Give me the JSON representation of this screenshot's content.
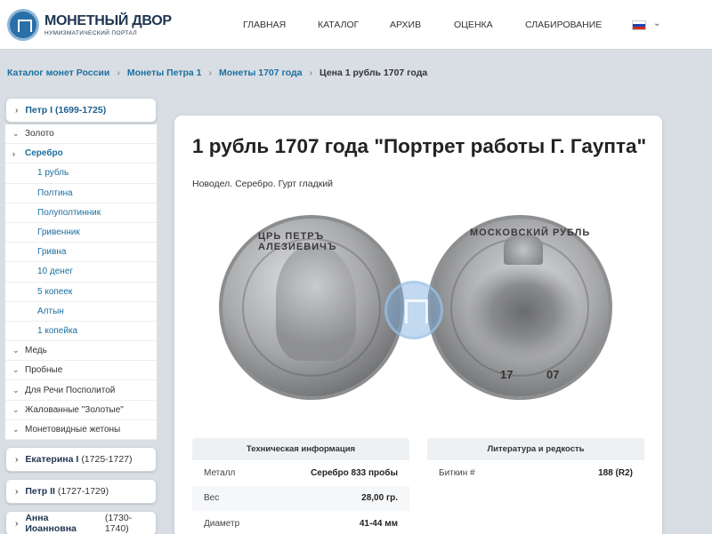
{
  "header": {
    "logo_title": "МОНЕТНЫЙ ДВОР",
    "logo_subtitle": "НУМИЗМАТИЧЕСКИЙ ПОРТАЛ",
    "nav": [
      "ГЛАВНАЯ",
      "КАТАЛОГ",
      "АРХИВ",
      "ОЦЕНКА",
      "СЛАБИРОВАНИЕ"
    ],
    "language_flag": "russia-flag-icon"
  },
  "breadcrumb": {
    "items": [
      "Каталог монет России",
      "Монеты Петра 1",
      "Монеты 1707 года"
    ],
    "current": "Цена 1 рубль 1707 года"
  },
  "sidebar": {
    "active_group": {
      "name": "Петр I",
      "years": "(1699-1725)"
    },
    "items": [
      {
        "label": "Золото",
        "expanded": false
      },
      {
        "label": "Серебро",
        "expanded": true
      }
    ],
    "silver_sub": [
      "1 рубль",
      "Полтина",
      "Полуполтинник",
      "Гривенник",
      "Гривна",
      "10 денег",
      "5 копеек",
      "Алтын",
      "1 копейка"
    ],
    "more_items": [
      "Медь",
      "Пробные",
      "Для Речи Посполитой",
      "Жалованные \"Золотые\"",
      "Монетовидные жетоны"
    ],
    "groups": [
      {
        "name": "Екатерина I",
        "years": "(1725-1727)"
      },
      {
        "name": "Петр II",
        "years": "(1727-1729)"
      },
      {
        "name": "Анна Иоанновна",
        "years": "(1730-1740)"
      }
    ]
  },
  "main": {
    "title": "1 рубль 1707 года \"Портрет работы Г. Гаупта\"",
    "subtitle": "Новодел. Серебро. Гурт гладкий",
    "obverse_legend": "ЦРЬ ПЕТРЪ АЛЕЗИЕВИЧЪ",
    "reverse_legend": "МОСКОВСКИЙ РУБЛЬ",
    "year_left": "17",
    "year_right": "07",
    "tech_table": {
      "title": "Техническая информация",
      "rows": [
        {
          "key": "Металл",
          "value": "Серебро 833 пробы"
        },
        {
          "key": "Вес",
          "value": "28,00 гр."
        },
        {
          "key": "Диаметр",
          "value": "41-44 мм"
        }
      ]
    },
    "lit_table": {
      "title": "Литература и редкость",
      "rows": [
        {
          "key": "Биткин #",
          "value": "188 (R2)"
        }
      ]
    }
  }
}
